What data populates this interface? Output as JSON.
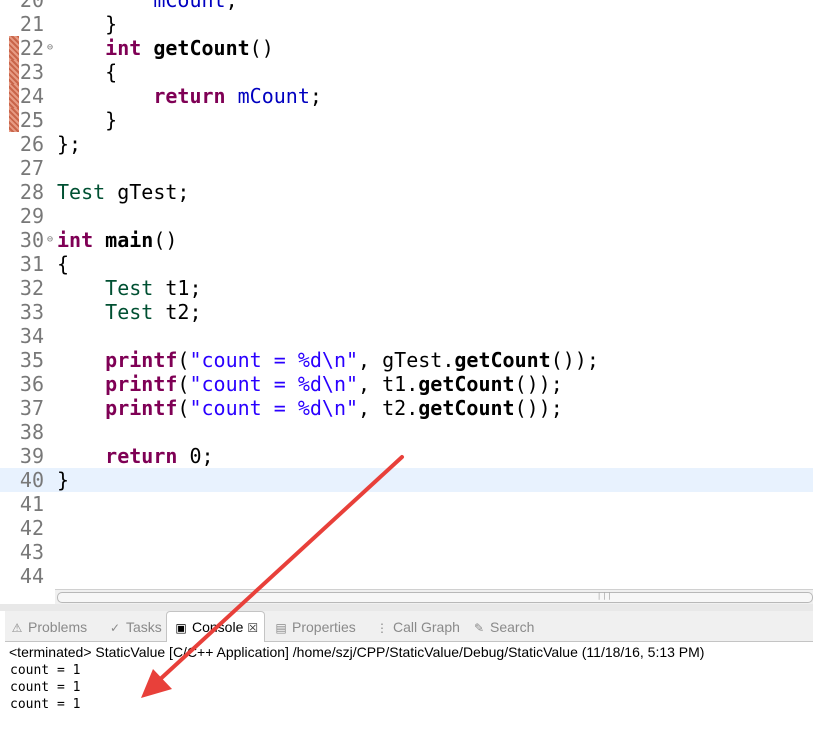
{
  "editor": {
    "lines": [
      {
        "n": "20",
        "text": "        mCount;"
      },
      {
        "n": "21",
        "text": "    }"
      },
      {
        "n": "22",
        "text": "    int getCount()"
      },
      {
        "n": "23",
        "text": "    {"
      },
      {
        "n": "24",
        "text": "        return mCount;"
      },
      {
        "n": "25",
        "text": "    }"
      },
      {
        "n": "26",
        "text": "};"
      },
      {
        "n": "27",
        "text": ""
      },
      {
        "n": "28",
        "text": "Test gTest;"
      },
      {
        "n": "29",
        "text": ""
      },
      {
        "n": "30",
        "text": "int main()"
      },
      {
        "n": "31",
        "text": "{"
      },
      {
        "n": "32",
        "text": "    Test t1;"
      },
      {
        "n": "33",
        "text": "    Test t2;"
      },
      {
        "n": "34",
        "text": ""
      },
      {
        "n": "35",
        "text": "    printf(\"count = %d\\n\", gTest.getCount());"
      },
      {
        "n": "36",
        "text": "    printf(\"count = %d\\n\", t1.getCount());"
      },
      {
        "n": "37",
        "text": "    printf(\"count = %d\\n\", t2.getCount());"
      },
      {
        "n": "38",
        "text": ""
      },
      {
        "n": "39",
        "text": "    return 0;"
      },
      {
        "n": "40",
        "text": "}"
      },
      {
        "n": "41",
        "text": ""
      },
      {
        "n": "42",
        "text": ""
      },
      {
        "n": "43",
        "text": ""
      },
      {
        "n": "44",
        "text": ""
      }
    ],
    "fold_glyph": "⊖"
  },
  "tabs": [
    {
      "label": "Problems",
      "icon": "problems-icon",
      "glyph": "⚠"
    },
    {
      "label": "Tasks",
      "icon": "tasks-icon",
      "glyph": "✓"
    },
    {
      "label": "Console",
      "icon": "console-icon",
      "glyph": "▣"
    },
    {
      "label": "Properties",
      "icon": "properties-icon",
      "glyph": "▤"
    },
    {
      "label": "Call Graph",
      "icon": "call-graph-icon",
      "glyph": "⋮"
    },
    {
      "label": "Search",
      "icon": "search-icon",
      "glyph": "✎"
    }
  ],
  "close_glyph": "☒",
  "console": {
    "header": "<terminated> StaticValue [C/C++ Application] /home/szj/CPP/StaticValue/Debug/StaticValue (11/18/16, 5:13 PM)",
    "output": [
      "count = 1",
      "count = 1",
      "count = 1"
    ]
  },
  "colors": {
    "keyword": "#7f0055",
    "type": "#005032",
    "string": "#2a00ff",
    "field": "#0000c0",
    "arrow": "#e8403a",
    "current_line": "#e8f2fe"
  }
}
